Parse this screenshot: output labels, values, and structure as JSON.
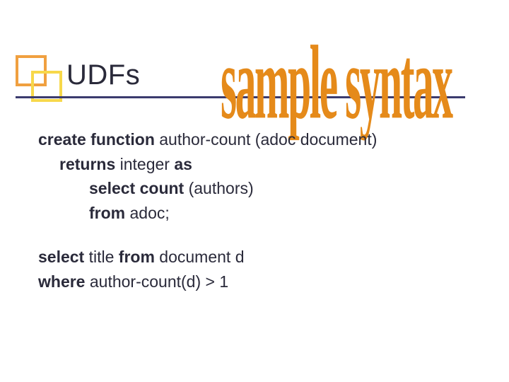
{
  "title": "UDFs",
  "watermark": "sample syntax",
  "code": {
    "l1_kw": "create function",
    "l1_rest": " author-count (adoc document)",
    "l2_kw1": "returns",
    "l2_mid": " integer ",
    "l2_kw2": "as",
    "l3_kw": "select count",
    "l3_rest": " (authors)",
    "l4_kw": "from",
    "l4_rest": " adoc;",
    "l5_kw1": "select",
    "l5_mid1": " title ",
    "l5_kw2": "from",
    "l5_rest": " document d",
    "l6_kw": "where",
    "l6_rest": " author-count(d) > 1"
  }
}
